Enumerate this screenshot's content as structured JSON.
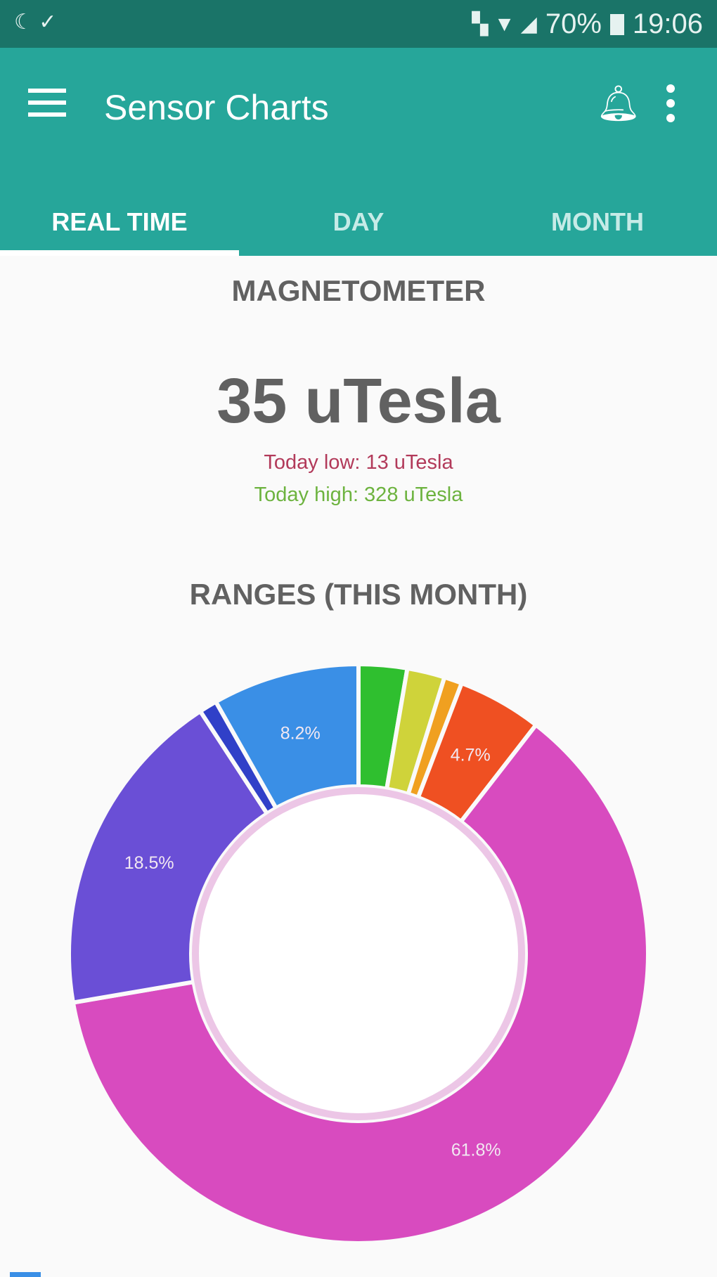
{
  "status_bar": {
    "left_icons": [
      "moon-icon",
      "signal-check-icon"
    ],
    "battery": "70%",
    "time": "19:06"
  },
  "app_bar": {
    "title": "Sensor Charts",
    "icons": [
      "menu-icon",
      "bell-icon",
      "more-vert-icon"
    ]
  },
  "tabs": [
    {
      "label": "REAL TIME",
      "active": true
    },
    {
      "label": "DAY",
      "active": false
    },
    {
      "label": "MONTH",
      "active": false
    }
  ],
  "sensor": {
    "name": "MAGNETOMETER",
    "value": "35 uTesla",
    "low": "Today low: 13 uTesla",
    "high": "Today high: 328 uTesla",
    "low_color": "#b23a5a",
    "high_color": "#6db33f"
  },
  "ranges_title": "RANGES (THIS MONTH)",
  "chart_data": {
    "type": "pie",
    "donut": true,
    "title": "RANGES (THIS MONTH)",
    "slices": [
      {
        "value": 2.7,
        "label": "",
        "color": "#2fbf2f"
      },
      {
        "value": 2.1,
        "label": "",
        "color": "#cfd33a"
      },
      {
        "value": 1.0,
        "label": "",
        "color": "#f0a020"
      },
      {
        "value": 4.7,
        "label": "4.7%",
        "color": "#ef5022"
      },
      {
        "value": 61.8,
        "label": "61.8%",
        "color": "#d84bbf"
      },
      {
        "value": 18.5,
        "label": "18.5%",
        "color": "#6a4fd6"
      },
      {
        "value": 1.0,
        "label": "",
        "color": "#3040c8"
      },
      {
        "value": 8.2,
        "label": "8.2%",
        "color": "#3a8fe6"
      }
    ]
  }
}
